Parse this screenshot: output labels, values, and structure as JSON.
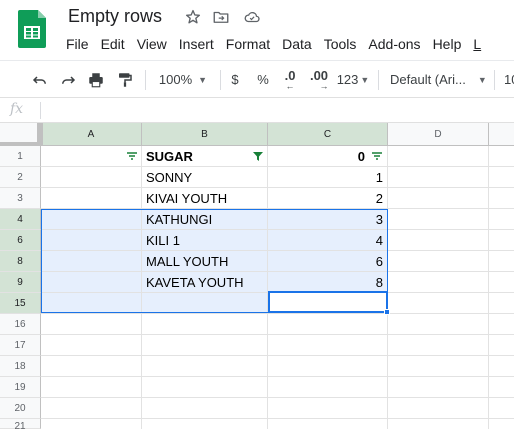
{
  "document": {
    "title": "Empty rows"
  },
  "icons": {
    "app": "sheets-logo-icon",
    "star": "star-icon",
    "move": "move-to-folder-icon",
    "cloud": "cloud-status-icon"
  },
  "menu": [
    "File",
    "Edit",
    "View",
    "Insert",
    "Format",
    "Data",
    "Tools",
    "Add-ons",
    "Help",
    "L"
  ],
  "toolbar": {
    "zoom": "100%",
    "currency": "$",
    "percent": "%",
    "decrease_decimals": ".0",
    "increase_decimals": ".00",
    "more_formats": "123",
    "font": "Default (Ari...",
    "font_size": "10"
  },
  "formula_bar": {
    "fx_label": "fx",
    "value": ""
  },
  "columns": [
    "A",
    "B",
    "C",
    "D"
  ],
  "rows": [
    {
      "num": "1",
      "a": "",
      "b": "SUGAR",
      "c": "0"
    },
    {
      "num": "2",
      "a": "",
      "b": "SONNY",
      "c": "1"
    },
    {
      "num": "3",
      "a": "",
      "b": "KIVAI YOUTH",
      "c": "2"
    },
    {
      "num": "4",
      "a": "",
      "b": "KATHUNGI",
      "c": "3"
    },
    {
      "num": "6",
      "a": "",
      "b": "KILI 1",
      "c": "4"
    },
    {
      "num": "8",
      "a": "",
      "b": "MALL YOUTH",
      "c": "6"
    },
    {
      "num": "9",
      "a": "",
      "b": "KAVETA YOUTH",
      "c": "8"
    },
    {
      "num": "15",
      "a": "",
      "b": "",
      "c": ""
    },
    {
      "num": "16",
      "a": "",
      "b": "",
      "c": ""
    },
    {
      "num": "17",
      "a": "",
      "b": "",
      "c": ""
    },
    {
      "num": "18",
      "a": "",
      "b": "",
      "c": ""
    },
    {
      "num": "19",
      "a": "",
      "b": "",
      "c": ""
    },
    {
      "num": "20",
      "a": "",
      "b": "",
      "c": ""
    },
    {
      "num": "21",
      "a": "",
      "b": "",
      "c": ""
    }
  ],
  "selection": {
    "range": "A4:C15",
    "active_cell": "C15"
  },
  "colors": {
    "sheets_green": "#0f9d58",
    "selection_blue": "#1a73e8",
    "selection_fill": "#e6effd",
    "header_selected": "#d3e3d5"
  }
}
